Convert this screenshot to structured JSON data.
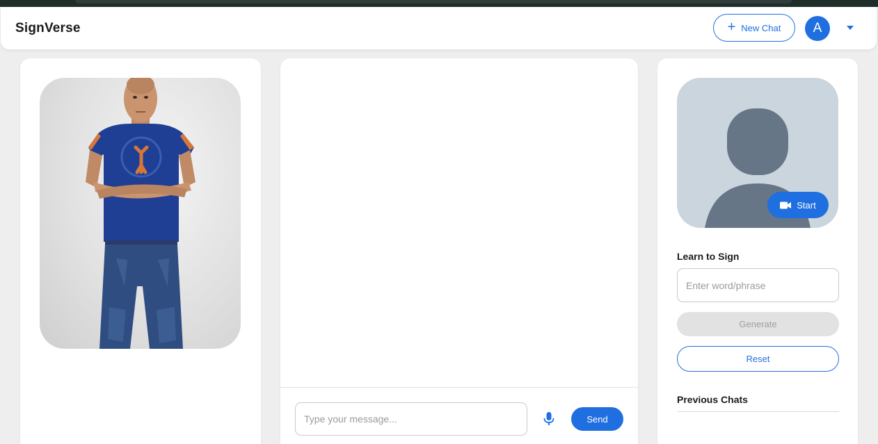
{
  "header": {
    "brand": "SignVerse",
    "new_chat_label": "New Chat",
    "avatar_initial": "A"
  },
  "chat": {
    "input_placeholder": "Type your message...",
    "input_value": "",
    "send_label": "Send"
  },
  "learn": {
    "start_label": "Start",
    "title": "Learn to Sign",
    "input_placeholder": "Enter word/phrase",
    "input_value": "",
    "generate_label": "Generate",
    "reset_label": "Reset",
    "previous_title": "Previous Chats"
  },
  "colors": {
    "accent": "#1f6fe0",
    "placeholder_silhouette": "#677686",
    "placeholder_bg": "#cbd5dd",
    "disabled_bg": "#e2e2e2"
  },
  "icons": {
    "new_chat": "plus-icon",
    "menu": "chevron-down-icon",
    "mic": "microphone-icon",
    "start": "video-camera-icon"
  }
}
